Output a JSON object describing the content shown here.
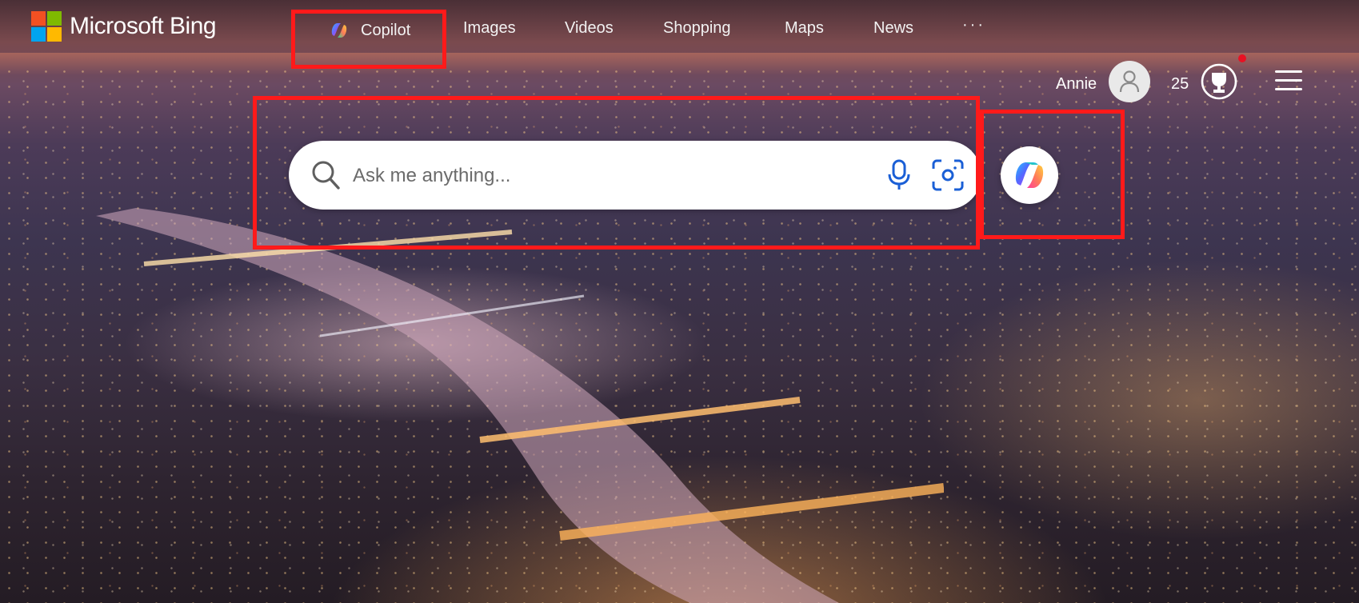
{
  "header": {
    "logo_text": "Microsoft Bing",
    "logo_colors": [
      "#f25022",
      "#7fba00",
      "#00a4ef",
      "#ffb900"
    ],
    "nav": [
      {
        "label": "Copilot",
        "icon": "copilot-icon"
      },
      {
        "label": "Images"
      },
      {
        "label": "Videos"
      },
      {
        "label": "Shopping"
      },
      {
        "label": "Maps"
      },
      {
        "label": "News"
      }
    ],
    "more_label": "···"
  },
  "user": {
    "name": "Annie",
    "avatar_icon": "user-avatar-icon",
    "points": "25",
    "rewards_icon": "rewards-trophy-icon",
    "menu_icon": "hamburger-menu-icon"
  },
  "search": {
    "placeholder": "Ask me anything...",
    "value": "",
    "search_icon": "search-icon",
    "voice_icon": "microphone-icon",
    "visual_search_icon": "camera-visual-search-icon",
    "copilot_icon": "copilot-icon"
  },
  "colors": {
    "highlight": "#ff1a1a",
    "accent_blue": "#1a5fd6"
  }
}
